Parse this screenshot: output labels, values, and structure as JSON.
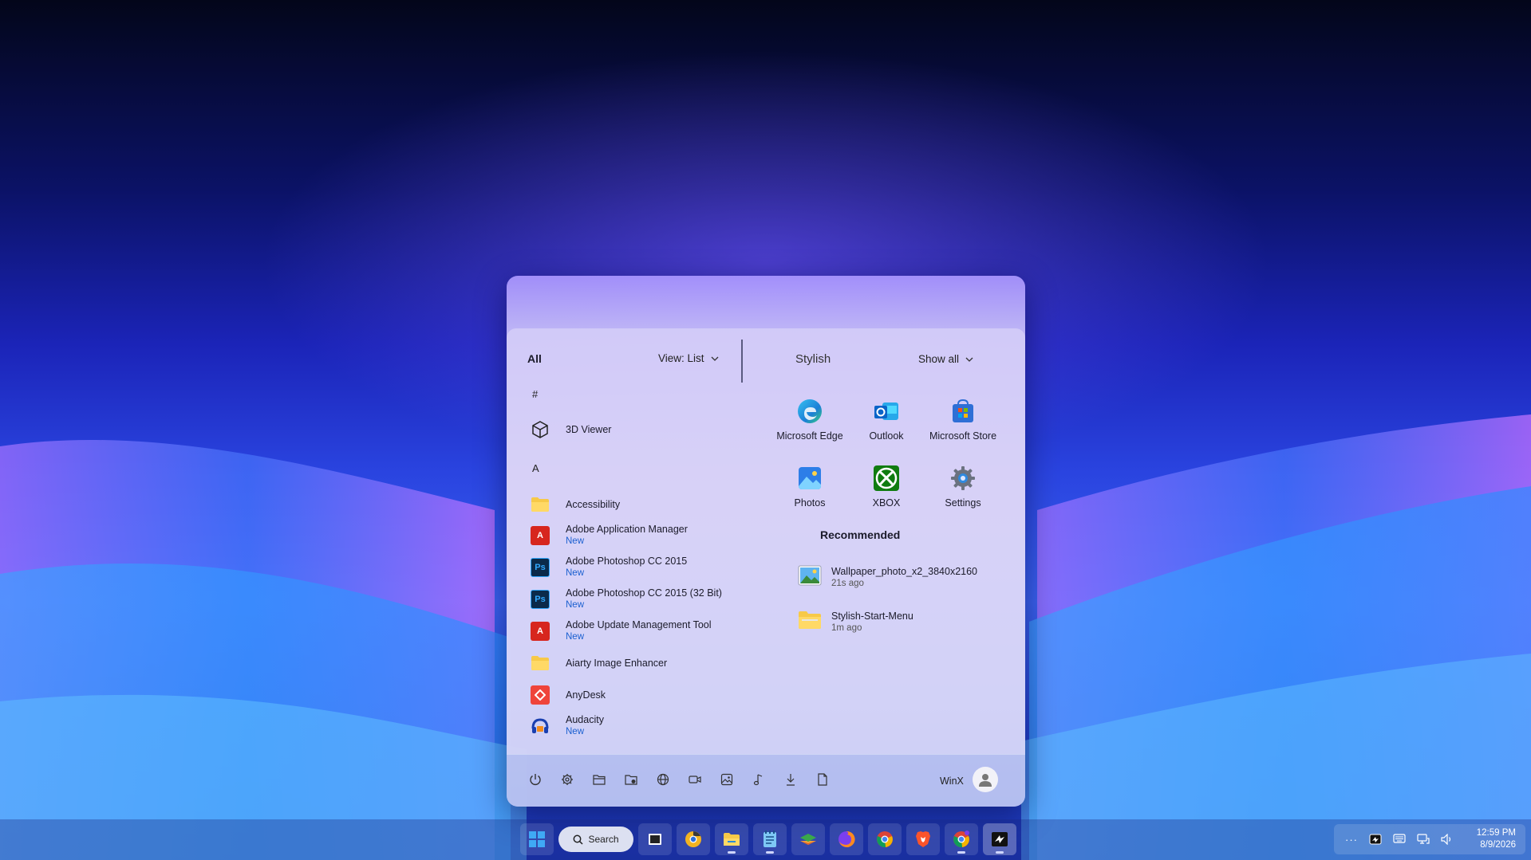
{
  "start_menu": {
    "all_label": "All",
    "view_label": "View: List",
    "section_title": "Stylish",
    "show_all_label": "Show all",
    "letters": [
      "#",
      "A"
    ],
    "apps": [
      {
        "name": "3D Viewer",
        "badge": "",
        "icon": "cube-icon"
      },
      {
        "name": "Accessibility",
        "badge": "",
        "icon": "folder-icon"
      },
      {
        "name": "Adobe Application Manager",
        "badge": "New",
        "icon": "adobe-icon"
      },
      {
        "name": "Adobe Photoshop CC 2015",
        "badge": "New",
        "icon": "photoshop-icon"
      },
      {
        "name": "Adobe Photoshop CC 2015 (32 Bit)",
        "badge": "New",
        "icon": "photoshop-icon"
      },
      {
        "name": "Adobe Update Management Tool",
        "badge": "New",
        "icon": "adobe-icon"
      },
      {
        "name": "Aiarty Image Enhancer",
        "badge": "",
        "icon": "folder-icon"
      },
      {
        "name": "AnyDesk",
        "badge": "",
        "icon": "anydesk-icon"
      },
      {
        "name": "Audacity",
        "badge": "New",
        "icon": "audacity-icon"
      }
    ],
    "icon_text": {
      "adobe": "A",
      "photoshop": "Ps"
    },
    "pinned": [
      {
        "label": "Microsoft Edge",
        "icon": "edge-icon"
      },
      {
        "label": "Outlook",
        "icon": "outlook-icon"
      },
      {
        "label": "Microsoft Store",
        "icon": "store-icon"
      },
      {
        "label": "Photos",
        "icon": "photos-icon"
      },
      {
        "label": "XBOX",
        "icon": "xbox-icon"
      },
      {
        "label": "Settings",
        "icon": "settings-gear-icon"
      }
    ],
    "recommended_title": "Recommended",
    "recommended": [
      {
        "name": "Wallpaper_photo_x2_3840x2160",
        "time": "21s ago",
        "icon": "image-file-icon"
      },
      {
        "name": "Stylish-Start-Menu",
        "time": "1m ago",
        "icon": "folder-icon"
      }
    ],
    "footer_icons": [
      "power-icon",
      "gear-icon",
      "folder-open-icon",
      "network-folder-icon",
      "globe-icon",
      "video-icon",
      "picture-icon",
      "music-icon",
      "download-icon",
      "document-icon"
    ],
    "user_name": "WinX"
  },
  "taskbar": {
    "search_label": "Search",
    "apps": [
      "windows-start-icon",
      "task-view-icon",
      "chrome-canary-icon",
      "file-explorer-icon",
      "notepad-icon",
      "layers-icon",
      "firefox-icon",
      "chrome-icon",
      "brave-icon",
      "chrome-dev-icon",
      "hyper-icon"
    ],
    "tray_icons": [
      "more-icon",
      "app-tray-icon",
      "keyboard-icon",
      "network-icon",
      "volume-icon"
    ],
    "tray_more_glyph": "···",
    "time": "12:59 PM",
    "date": "8/9/2026"
  },
  "colors": {
    "accent_blue": "#1a5fd0",
    "adobe_red": "#d7261e",
    "photoshop_blue": "#0b2a4a",
    "anydesk_red": "#ef443b",
    "xbox_green": "#107c10"
  }
}
